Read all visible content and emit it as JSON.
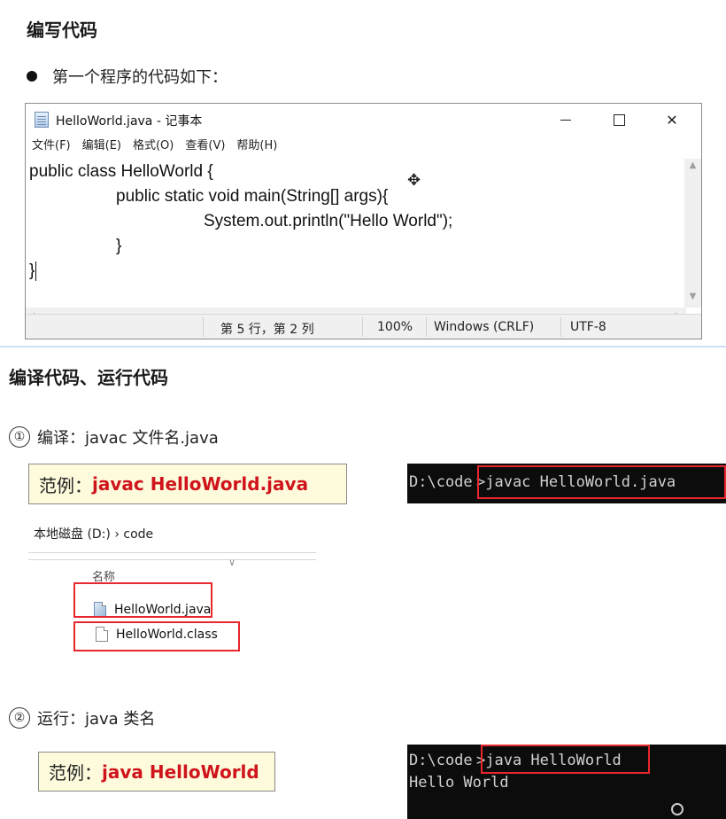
{
  "section1": {
    "heading": "编写代码",
    "bullet": "第一个程序的代码如下："
  },
  "notepad": {
    "title": "HelloWorld.java - 记事本",
    "menu": [
      "文件(F)",
      "编辑(E)",
      "格式(O)",
      "查看(V)",
      "帮助(H)"
    ],
    "code_lines": [
      "public class HelloWorld {",
      "public static void main(String[] args){",
      "System.out.println(\"Hello World\");",
      "}",
      "}"
    ],
    "status": {
      "position": "第 5 行，第 2 列",
      "zoom": "100%",
      "line_ending": "Windows (CRLF)",
      "encoding": "UTF-8"
    }
  },
  "section2": {
    "heading": "编译代码、运行代码"
  },
  "compile": {
    "step_number": "①",
    "step_label": "编译：javac 文件名.java",
    "example_prefix": "范例：",
    "example_command": "javac HelloWorld.java",
    "console_prompt": "D:\\code",
    "console_command": ">javac HelloWorld.java"
  },
  "explorer": {
    "breadcrumb": "本地磁盘 (D:)  ›  code",
    "column_name": "名称",
    "files": [
      "HelloWorld.java",
      "HelloWorld.class"
    ]
  },
  "run": {
    "step_number": "②",
    "step_label": "运行：java 类名",
    "example_prefix": "范例：",
    "example_command": "java HelloWorld",
    "console_prompt": "D:\\code",
    "console_command": ">java HelloWorld",
    "console_output": "Hello World"
  }
}
